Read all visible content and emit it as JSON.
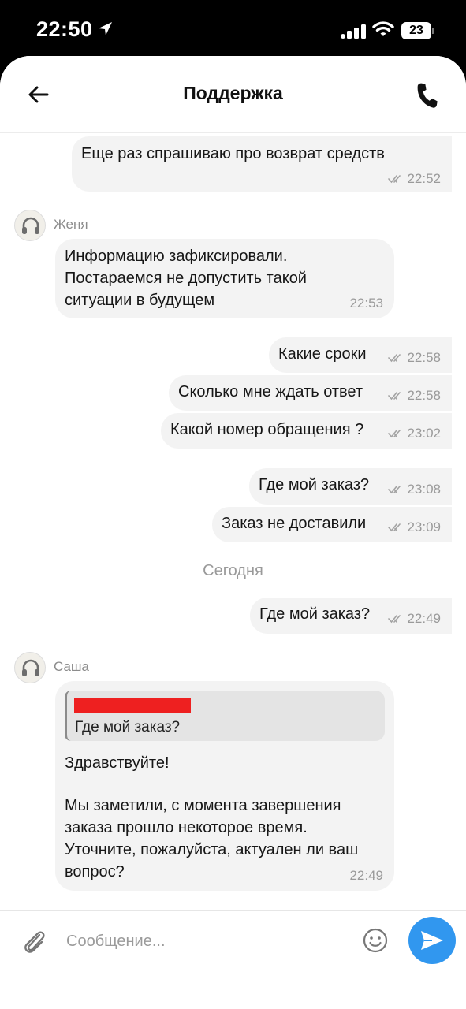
{
  "status_bar": {
    "time": "22:50",
    "battery": "23"
  },
  "header": {
    "title": "Поддержка"
  },
  "messages": {
    "m1": {
      "text": "Еще раз спрашиваю про возврат средств",
      "time": "22:52"
    },
    "zhenya": {
      "author": "Женя",
      "line1": "Информацию зафиксировали.",
      "line2": "Постараемся не допустить такой",
      "line3": "ситуации в будущем",
      "time": "22:53"
    },
    "m2": {
      "text": "Какие сроки",
      "time": "22:58"
    },
    "m3": {
      "text": "Сколько мне ждать ответ",
      "time": "22:58"
    },
    "m4": {
      "text": "Какой номер обращения ?",
      "time": "23:02"
    },
    "m5": {
      "text": "Где мой заказ?",
      "time": "23:08"
    },
    "m6": {
      "text": "Заказ не доставили",
      "time": "23:09"
    },
    "date_separator": "Сегодня",
    "m7": {
      "text": "Где мой заказ?",
      "time": "22:49"
    },
    "sasha": {
      "author": "Саша",
      "quote_text": "Где мой заказ?",
      "greeting": "Здравствуйте!",
      "line1": "Мы заметили, с момента завершения",
      "line2": "заказа прошло некоторое время.",
      "line3": "Уточните, пожалуйста, актуален ли ваш",
      "line4": "вопрос?",
      "time": "22:49"
    }
  },
  "composer": {
    "placeholder": "Сообщение..."
  },
  "colors": {
    "accent": "#3197ef",
    "bubble": "#f3f3f3",
    "redaction": "#ee2020"
  },
  "icons": [
    "location-arrow-icon",
    "signal-icon",
    "wifi-icon",
    "battery-icon",
    "back-arrow-icon",
    "phone-icon",
    "double-check-icon",
    "headset-icon",
    "paperclip-icon",
    "emoji-icon",
    "send-icon"
  ]
}
